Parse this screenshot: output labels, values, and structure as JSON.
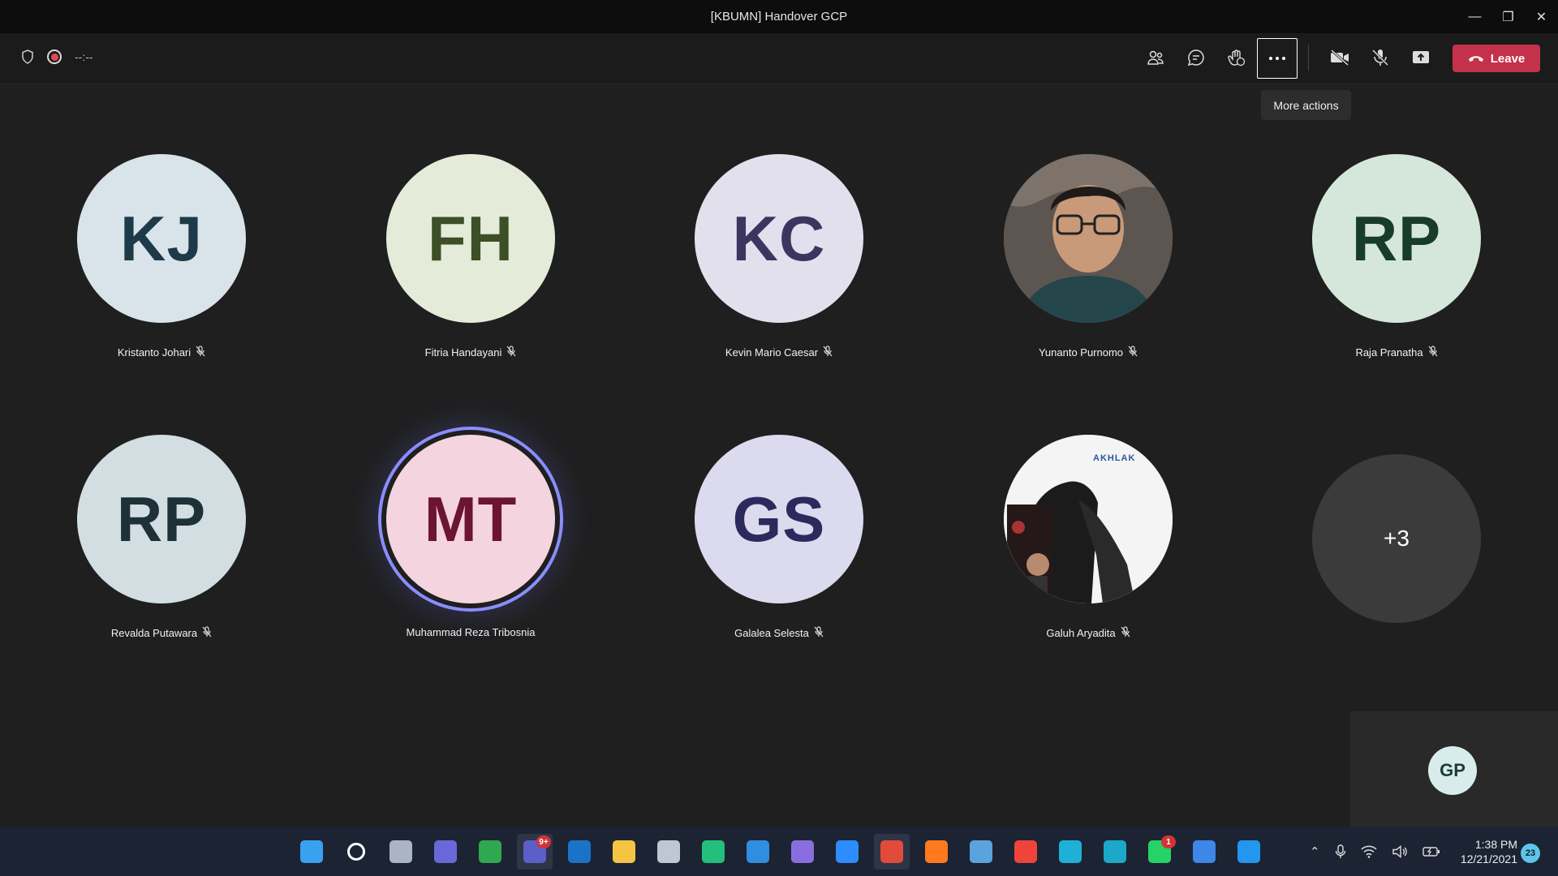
{
  "window": {
    "title": "[KBUMN] Handover GCP",
    "minimize": "—",
    "restore": "❐",
    "close": "✕"
  },
  "toolbar": {
    "timer": "--:--",
    "leave_label": "Leave",
    "tooltip": "More actions"
  },
  "participants": [
    {
      "initials": "KJ",
      "name": "Kristanto Johari",
      "bg": "#d8e4ea",
      "fg": "#1e3a48",
      "muted": true
    },
    {
      "initials": "FH",
      "name": "Fitria Handayani",
      "bg": "#e4ecd9",
      "fg": "#3d4f26",
      "muted": true
    },
    {
      "initials": "KC",
      "name": "Kevin Mario Caesar",
      "bg": "#e3e0ee",
      "fg": "#3b3660",
      "muted": true
    },
    {
      "initials": "",
      "name": "Yunanto Purnomo",
      "bg": "#8a7f76",
      "fg": "#fff",
      "muted": true,
      "photo": true
    },
    {
      "initials": "RP",
      "name": "Raja Pranatha",
      "bg": "#d5e6db",
      "fg": "#173c2a",
      "muted": true
    },
    {
      "initials": "RP",
      "name": "Revalda Putawara",
      "bg": "#d3dee2",
      "fg": "#1e3038",
      "muted": true
    },
    {
      "initials": "MT",
      "name": "Muhammad Reza Tribosnia",
      "bg": "#f4d4de",
      "fg": "#6b1434",
      "muted": false,
      "speaking": true
    },
    {
      "initials": "GS",
      "name": "Galalea Selesta",
      "bg": "#dcdaee",
      "fg": "#2c2a5c",
      "muted": true
    },
    {
      "initials": "",
      "name": "Galuh Aryadita",
      "bg": "#f2f2f2",
      "fg": "#000",
      "muted": true,
      "photo": true,
      "logo_text": "AKHLAK"
    }
  ],
  "overflow": {
    "label": "+3"
  },
  "self": {
    "initials": "GP"
  },
  "taskbar": {
    "apps": [
      {
        "name": "windows-start",
        "color": "#3aa0f0"
      },
      {
        "name": "search",
        "color": "#ffffff"
      },
      {
        "name": "task-view",
        "color": "#aab4c4"
      },
      {
        "name": "teams-chat",
        "color": "#6a68d8"
      },
      {
        "name": "ulauncher",
        "color": "#2fa84f"
      },
      {
        "name": "microsoft-teams",
        "color": "#5b5fc7",
        "badge": "9+",
        "active": true
      },
      {
        "name": "outlook",
        "color": "#1a73c8"
      },
      {
        "name": "file-explorer",
        "color": "#f4c542"
      },
      {
        "name": "cloud-app",
        "color": "#bfc7d4"
      },
      {
        "name": "vscode-insiders",
        "color": "#24bf7a"
      },
      {
        "name": "vscode",
        "color": "#2f8ee0"
      },
      {
        "name": "photos",
        "color": "#8a6ee0"
      },
      {
        "name": "zoom",
        "color": "#2d8cff"
      },
      {
        "name": "chrome",
        "color": "#e24a3a",
        "active": true
      },
      {
        "name": "firefox",
        "color": "#ff7a1e"
      },
      {
        "name": "remote-desktop",
        "color": "#5ba3dd"
      },
      {
        "name": "anydesk",
        "color": "#ef443b"
      },
      {
        "name": "edge",
        "color": "#1fb0d8"
      },
      {
        "name": "powertoys",
        "color": "#1ca9c9"
      },
      {
        "name": "whatsapp",
        "color": "#25d366",
        "badge": "1"
      },
      {
        "name": "todo",
        "color": "#3c87e8"
      },
      {
        "name": "docker",
        "color": "#2396ed"
      }
    ],
    "time": "1:38 PM",
    "date": "12/21/2021",
    "notifications": "23"
  }
}
